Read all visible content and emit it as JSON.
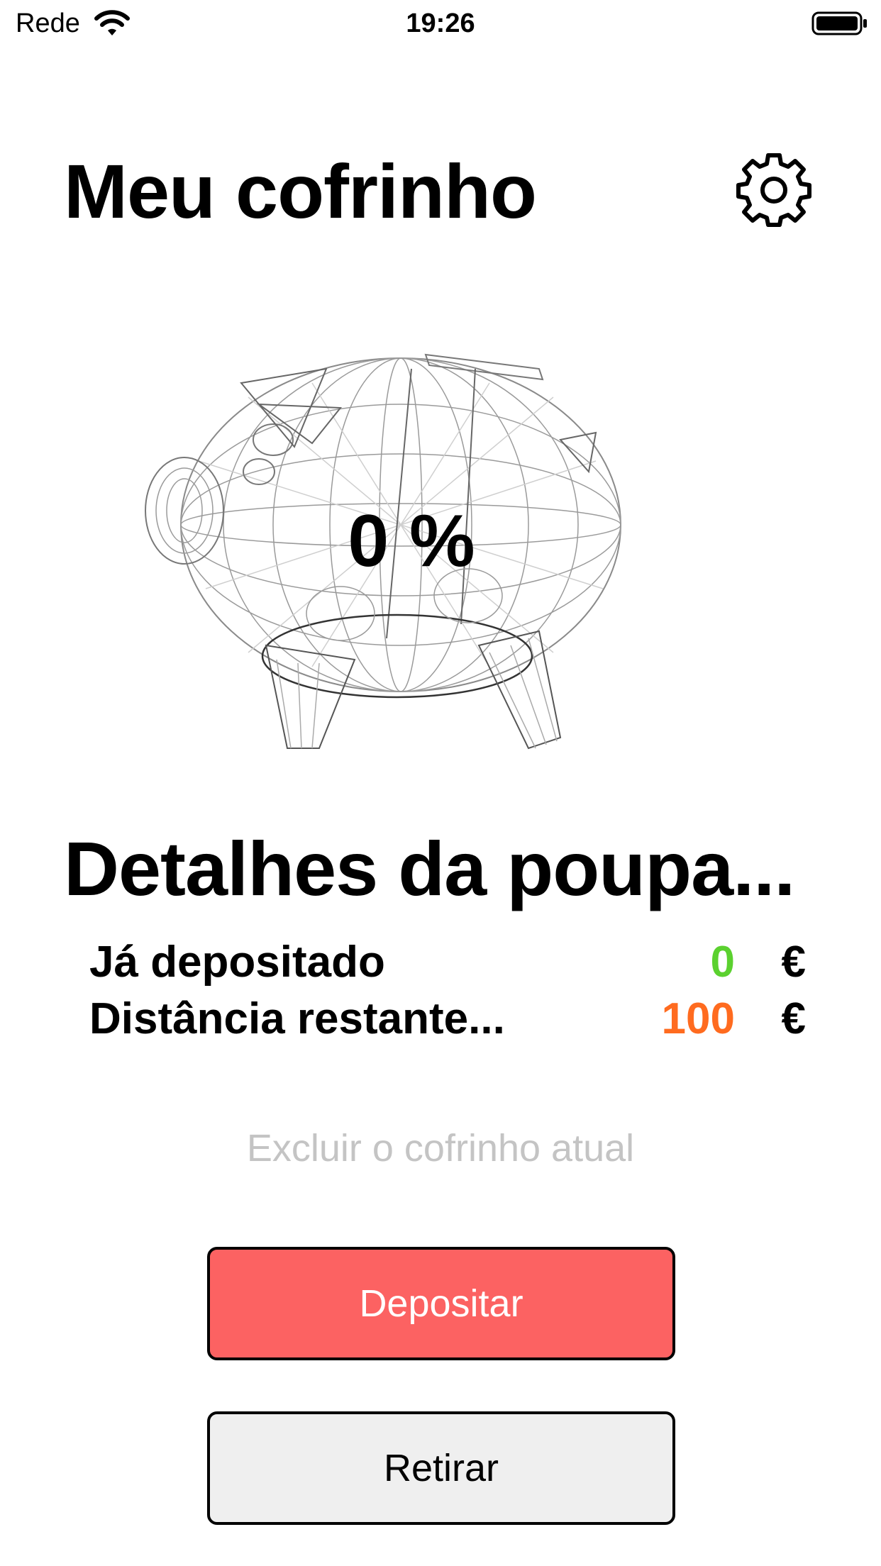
{
  "status_bar": {
    "carrier": "Rede",
    "time": "19:26",
    "wifi_icon": "wifi-icon",
    "battery_icon": "battery-icon"
  },
  "header": {
    "title": "Meu cofrinho",
    "settings_icon": "gear-icon"
  },
  "piggy_bank": {
    "image": "piggy-bank-wireframe",
    "progress_label": "0 %",
    "progress_fraction": 0
  },
  "details": {
    "title": "Detalhes da poupa...",
    "rows": [
      {
        "label": "Já depositado",
        "value": "0",
        "currency": "€",
        "value_color": "#5bd12f"
      },
      {
        "label": "Distância restante...",
        "value": "100",
        "currency": "€",
        "value_color": "#ff6b1f"
      }
    ]
  },
  "actions": {
    "delete_label": "Excluir o cofrinho atual",
    "deposit_label": "Depositar",
    "withdraw_label": "Retirar"
  },
  "colors": {
    "deposit_bg": "#fc6262",
    "withdraw_bg": "#efefef",
    "delete_text": "#c4c4c4"
  }
}
